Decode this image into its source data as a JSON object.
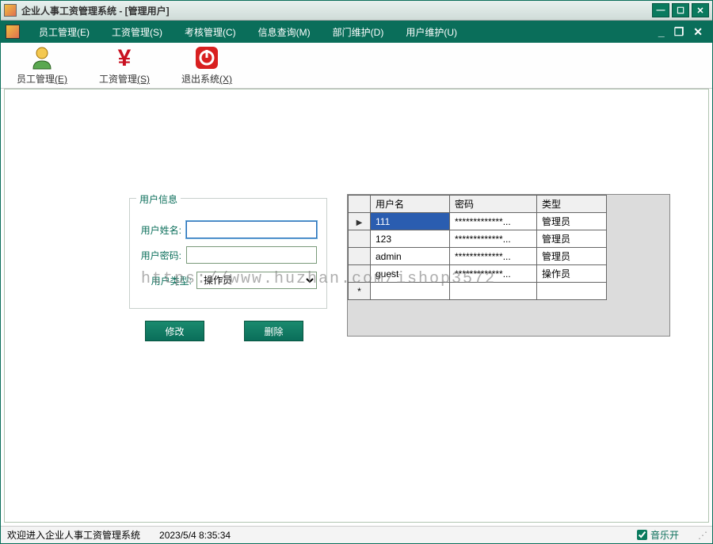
{
  "window": {
    "title": "企业人事工资管理系统 - [管理用户]"
  },
  "menu": {
    "items": [
      "员工管理(E)",
      "工资管理(S)",
      "考核管理(C)",
      "信息查询(M)",
      "部门维护(D)",
      "用户维护(U)"
    ]
  },
  "toolbar": {
    "employee": {
      "label": "员工管理",
      "accel": "(E)"
    },
    "salary": {
      "label": "工资管理",
      "accel": "(S)"
    },
    "exit": {
      "label": "退出系统",
      "accel": "(X)"
    }
  },
  "form": {
    "legend": "用户信息",
    "username_label": "用户姓名:",
    "username_value": "",
    "password_label": "用户密码:",
    "password_value": "",
    "type_label": "用户类型:",
    "type_value": "操作员"
  },
  "buttons": {
    "modify": "修改",
    "delete": "删除"
  },
  "grid": {
    "headers": [
      "用户名",
      "密码",
      "类型"
    ],
    "rows": [
      {
        "user": "111",
        "pass": "*************...",
        "type": "管理员",
        "selected": true
      },
      {
        "user": "123",
        "pass": "*************...",
        "type": "管理员",
        "selected": false
      },
      {
        "user": "admin",
        "pass": "*************...",
        "type": "管理员",
        "selected": false
      },
      {
        "user": "guest",
        "pass": "*************...",
        "type": "操作员",
        "selected": false
      }
    ]
  },
  "watermark": "https://www.huzhan.com/ishop3572",
  "status": {
    "welcome": "欢迎进入企业人事工资管理系统",
    "datetime": "2023/5/4 8:35:34",
    "music_label": "音乐开",
    "music_on": true
  }
}
